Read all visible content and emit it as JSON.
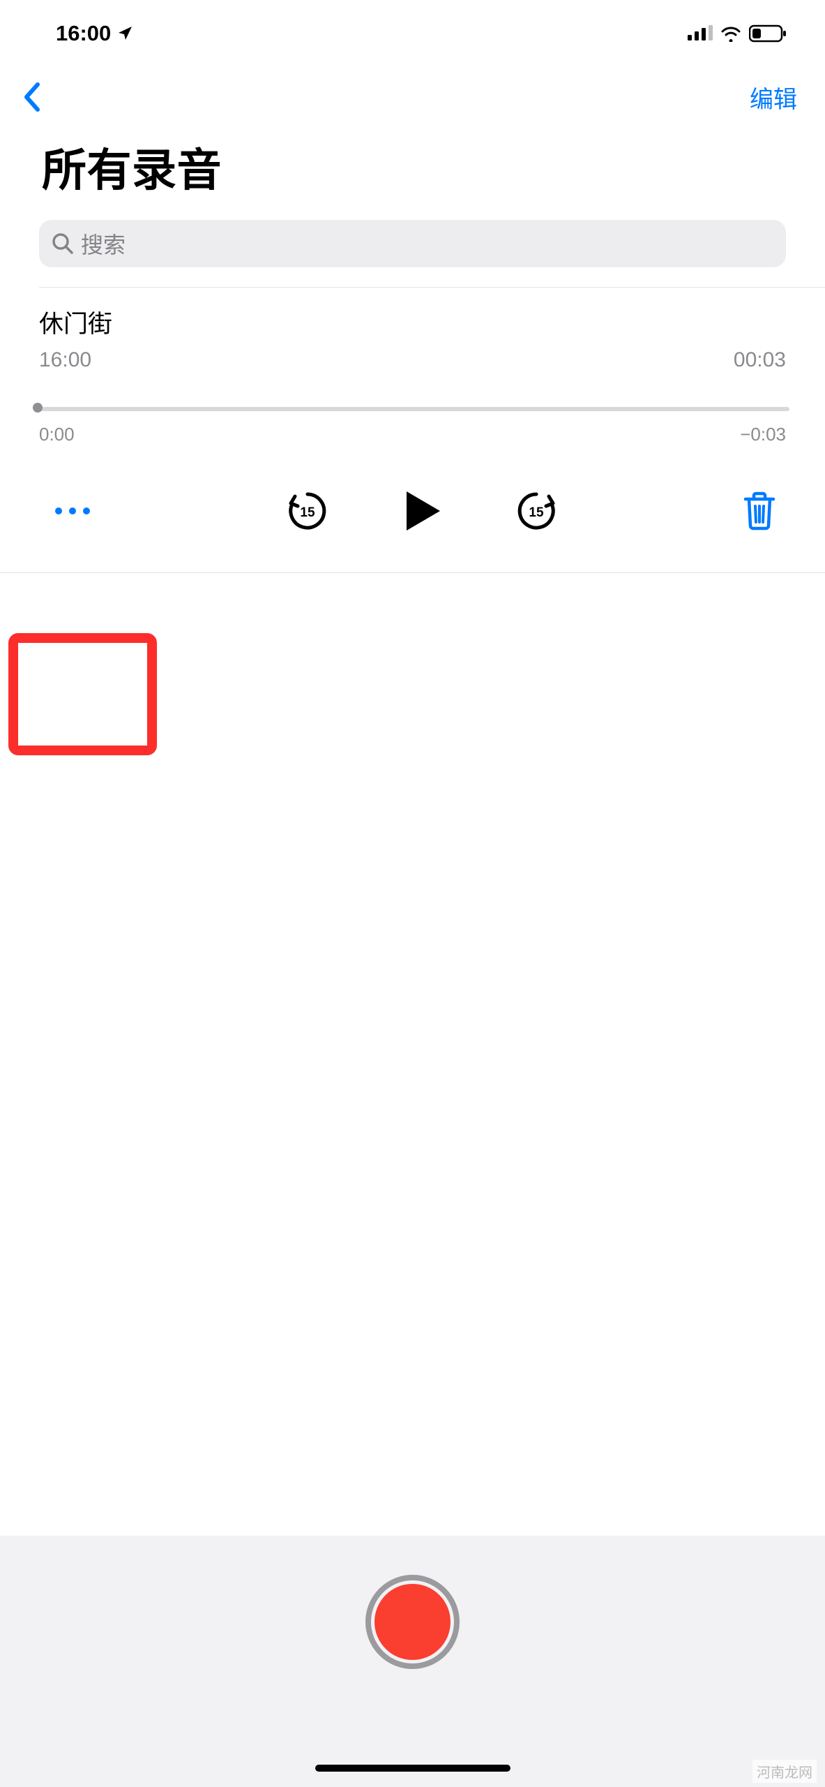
{
  "status": {
    "time": "16:00"
  },
  "nav": {
    "edit_label": "编辑"
  },
  "title": "所有录音",
  "search": {
    "placeholder": "搜索"
  },
  "recording": {
    "name": "休门街",
    "time": "16:00",
    "duration": "00:03",
    "scrub_start": "0:00",
    "scrub_end": "−0:03",
    "skip_seconds": "15"
  },
  "watermark": "河南龙网"
}
